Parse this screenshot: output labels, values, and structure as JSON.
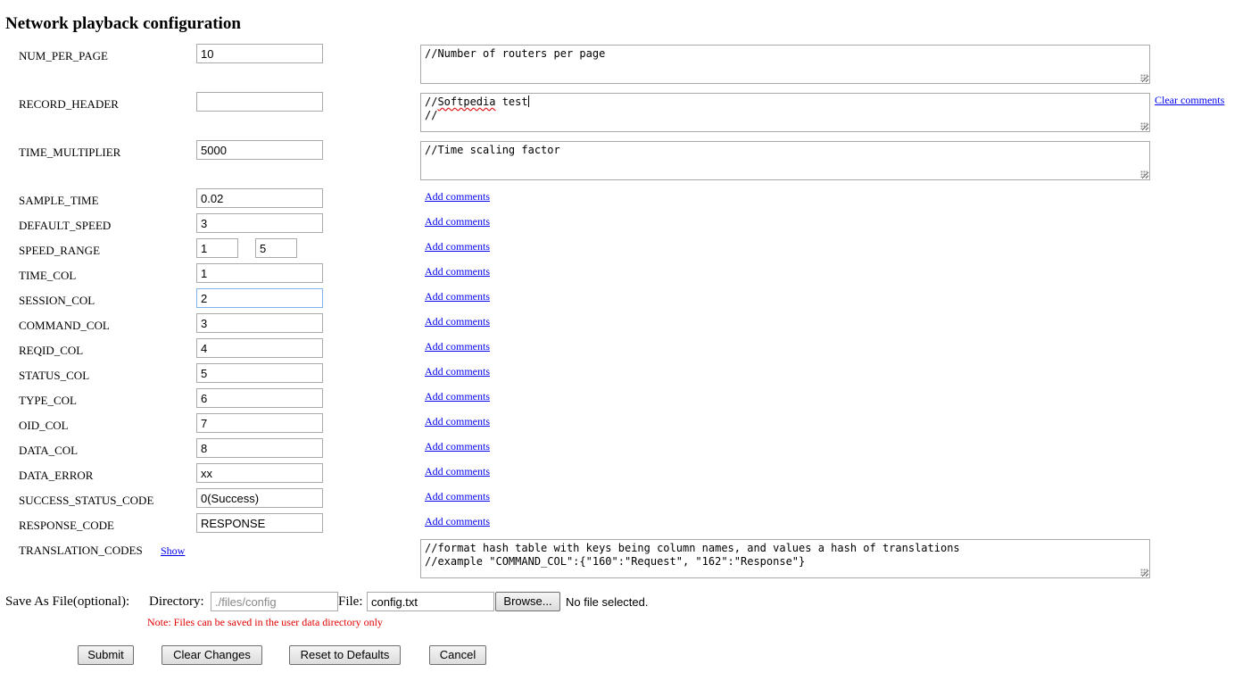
{
  "title": "Network playback configuration",
  "fields": [
    {
      "label": "NUM_PER_PAGE",
      "value": "10"
    },
    {
      "label": "RECORD_HEADER",
      "value": ""
    },
    {
      "label": "TIME_MULTIPLIER",
      "value": "5000"
    },
    {
      "label": "SAMPLE_TIME",
      "value": "0.02"
    },
    {
      "label": "DEFAULT_SPEED",
      "value": "3"
    },
    {
      "label": "SPEED_RANGE",
      "value": "1",
      "value2": "5"
    },
    {
      "label": "TIME_COL",
      "value": "1"
    },
    {
      "label": "SESSION_COL",
      "value": "2"
    },
    {
      "label": "COMMAND_COL",
      "value": "3"
    },
    {
      "label": "REQID_COL",
      "value": "4"
    },
    {
      "label": "STATUS_COL",
      "value": "5"
    },
    {
      "label": "TYPE_COL",
      "value": "6"
    },
    {
      "label": "OID_COL",
      "value": "7"
    },
    {
      "label": "DATA_COL",
      "value": "8"
    },
    {
      "label": "DATA_ERROR",
      "value": "xx"
    },
    {
      "label": "SUCCESS_STATUS_CODE",
      "value": "0(Success)"
    },
    {
      "label": "RESPONSE_CODE",
      "value": "RESPONSE"
    },
    {
      "label": "TRANSLATION_CODES",
      "value": ""
    }
  ],
  "comments": {
    "num_per_page": "//Number of routers per page",
    "record_header_line1_a": "//",
    "record_header_line1_b": "Softpedia",
    "record_header_line1_c": " test",
    "record_header_line2": "//",
    "time_multiplier": "//Time scaling factor",
    "translation_line1": "//format hash table with keys being column names, and values a hash of translations",
    "translation_line2": "//example \"COMMAND_COL\":{\"160\":\"Request\", \"162\":\"Response\"}"
  },
  "add_comments_label": "Add comments",
  "clear_comments_label": "Clear comments",
  "show_label": "Show",
  "save": {
    "label": "Save As File(optional):",
    "directory_label": "Directory:",
    "directory_value": "./files/config",
    "file_label": "File:",
    "file_value": "config.txt",
    "browse_label": "Browse...",
    "no_file_label": "No file selected.",
    "note": "Note: Files can be saved in the user data directory only"
  },
  "buttons": {
    "submit": "Submit",
    "clear_changes": "Clear Changes",
    "reset": "Reset to Defaults",
    "cancel": "Cancel"
  }
}
